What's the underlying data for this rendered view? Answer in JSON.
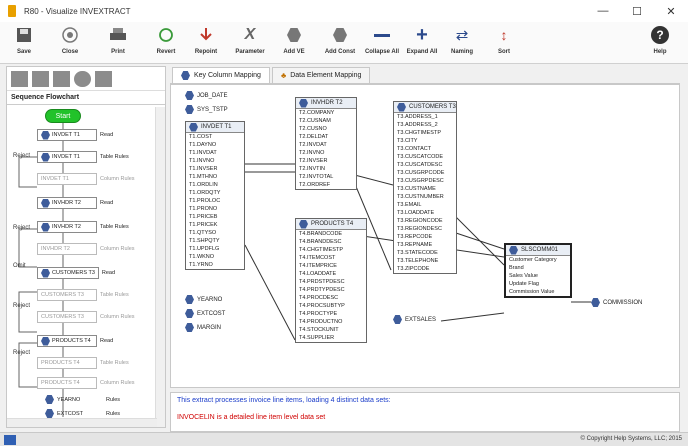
{
  "window": {
    "title": "R80 - Visualize INVEXTRACT",
    "min": "—",
    "max": "☐",
    "close": "✕"
  },
  "toolbar": [
    {
      "key": "save",
      "label": "Save"
    },
    {
      "key": "close",
      "label": "Close"
    },
    {
      "key": "print",
      "label": "Print"
    },
    {
      "key": "revert",
      "label": "Revert"
    },
    {
      "key": "repoint",
      "label": "Repoint"
    },
    {
      "key": "parameter",
      "label": "Parameter"
    },
    {
      "key": "add_ve",
      "label": "Add VE"
    },
    {
      "key": "add_const",
      "label": "Add Const"
    },
    {
      "key": "collapse_all",
      "label": "Collapse All"
    },
    {
      "key": "expand_all",
      "label": "Expand All"
    },
    {
      "key": "naming",
      "label": "Naming"
    },
    {
      "key": "sort",
      "label": "Sort"
    },
    {
      "key": "help",
      "label": "Help"
    }
  ],
  "left": {
    "title": "Sequence Flowchart",
    "start": "Start",
    "labels": {
      "reject": "Reject",
      "omit": "Omit"
    },
    "nodes": [
      {
        "name": "INVDET  T1",
        "type": "Read"
      },
      {
        "name": "INVDET  T1",
        "type": "Table Rules"
      },
      {
        "name": "INVDET  T1",
        "type": "Column Rules"
      },
      {
        "name": "INVHDR  T2",
        "type": "Read"
      },
      {
        "name": "INVHDR  T2",
        "type": "Table Rules"
      },
      {
        "name": "INVHDR  T2",
        "type": "Column Rules"
      },
      {
        "name": "CUSTOMERS T3",
        "type": "Read"
      },
      {
        "name": "CUSTOMERS T3",
        "type": "Table Rules"
      },
      {
        "name": "CUSTOMERS T3",
        "type": "Column Rules"
      },
      {
        "name": "PRODUCTS  T4",
        "type": "Read"
      },
      {
        "name": "PRODUCTS  T4",
        "type": "Table Rules"
      },
      {
        "name": "PRODUCTS  T4",
        "type": "Column Rules"
      },
      {
        "name": "YEARNO",
        "type": "Rules"
      },
      {
        "name": "EXTCOST",
        "type": "Rules"
      }
    ]
  },
  "tabs": [
    {
      "label": "Key Column Mapping"
    },
    {
      "label": "Data Element Mapping"
    }
  ],
  "canvas": {
    "chips": [
      "JOB_DATE",
      "SYS_TSTP",
      "YEARNO",
      "EXTCOST",
      "MARGIN",
      "EXTSALES",
      "COMMISSION"
    ],
    "t1": {
      "title": "INVDET  T1",
      "rows": [
        "T1.COST",
        "T1.DAYNO",
        "T1.INVDAT",
        "T1.INVNO",
        "T1.INVSER",
        "T1.MTHNO",
        "T1.ORDLIN",
        "T1.ORDQTY",
        "T1.PROLOC",
        "T1.PRONO",
        "T1.PRICEB",
        "T1.PRICEK",
        "T1.QTYSO",
        "T1.SHPQTY",
        "T1.UPDFLG",
        "T1.WKNO",
        "T1.YRNO"
      ]
    },
    "t2": {
      "title": "INVHDR  T2",
      "rows": [
        "T2.COMPANY",
        "T2.CUSNAM",
        "T2.CUSNO",
        "T2.DELDAT",
        "T2.INVDAT",
        "T2.INVNO",
        "T2.INVSER",
        "T2.INVTIN",
        "T2.INVTOTAL",
        "T2.ORDREF"
      ]
    },
    "t3": {
      "title": "CUSTOMERS T3",
      "rows": [
        "T3.ADDRESS_1",
        "T3.ADDRESS_2",
        "T3.CHGTIMESTP",
        "T3.CITY",
        "T3.CONTACT",
        "T3.CUSCATCODE",
        "T3.CUSCATDESC",
        "T3.CUSGRPCODE",
        "T3.CUSGRPDESC",
        "T3.CUSTNAME",
        "T3.CUSTNUMBER",
        "T3.EMAIL",
        "T3.LOADDATE",
        "T3.REGIONCODE",
        "T3.REGIONDESC",
        "T3.REPCODE",
        "T3.REPNAME",
        "T3.STATECODE",
        "T3.TELEPHONE",
        "T3.ZIPCODE"
      ]
    },
    "t4": {
      "title": "PRODUCTS  T4",
      "rows": [
        "T4.BRANDCODE",
        "T4.BRANDDESC",
        "T4.CHGTIMESTP",
        "T4.ITEMCOST",
        "T4.ITEMPRICE",
        "T4.LOADDATE",
        "T4.PRDSTPDESC",
        "T4.PRDTYPDESC",
        "T4.PROCDESC",
        "T4.PROCSUBTYP",
        "T4.PROCTYPE",
        "T4.PRODUCTNO",
        "T4.STOCKUNIT",
        "T4.SUPPLIER"
      ]
    },
    "t5": {
      "title": "SLSCOMM01",
      "rows": [
        "Customer Category",
        "Brand",
        "Sales Value",
        "Update Flag",
        "Commission Value"
      ]
    }
  },
  "status": {
    "line1": "This extract processes invoice line items, loading 4 distinct data sets:",
    "line2": "INVOCELIN is a detailed line item level data set"
  },
  "footer": {
    "copyright": "© Copyright Help Systems, LLC; 2015"
  },
  "colors": {
    "icon_blue": "#3e5c9a",
    "status_blue": "#1a3cc9",
    "status_red": "#d00000",
    "start_green": "#22c22a"
  }
}
